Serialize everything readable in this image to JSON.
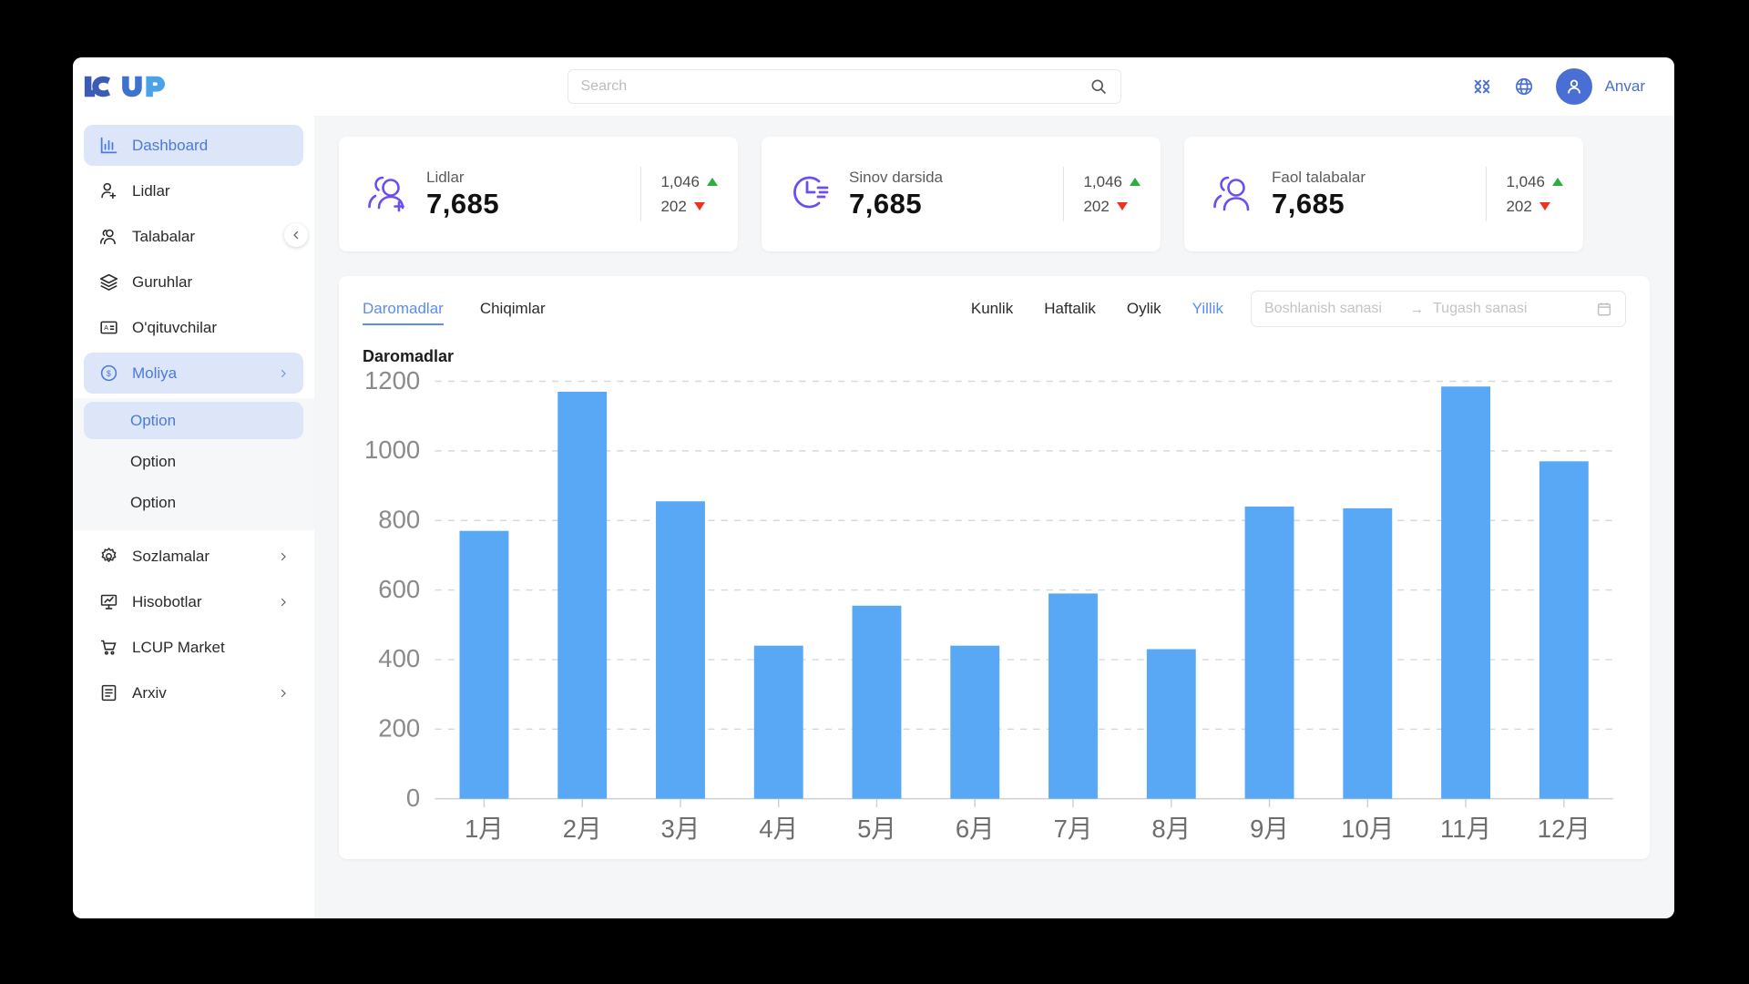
{
  "brand": {
    "logo_text": "LCUP"
  },
  "topbar": {
    "search": {
      "placeholder": "Search",
      "value": ""
    },
    "user_name": "Anvar",
    "icons": [
      "compress-icon",
      "globe-icon",
      "user-avatar-icon"
    ]
  },
  "sidebar": {
    "items": [
      {
        "label": "Dashboard",
        "icon": "bar-chart-icon",
        "active": true,
        "chevron": false
      },
      {
        "label": "Lidlar",
        "icon": "user-plus-icon",
        "active": false,
        "chevron": false
      },
      {
        "label": "Talabalar",
        "icon": "users-icon",
        "active": false,
        "chevron": false
      },
      {
        "label": "Guruhlar",
        "icon": "layers-icon",
        "active": false,
        "chevron": false
      },
      {
        "label": "O'qituvchilar",
        "icon": "id-card-icon",
        "active": false,
        "chevron": false
      },
      {
        "label": "Moliya",
        "icon": "dollar-circle-icon",
        "active": true,
        "chevron": true
      }
    ],
    "submenu": [
      {
        "label": "Option",
        "active": true
      },
      {
        "label": "Option",
        "active": false
      },
      {
        "label": "Option",
        "active": false
      }
    ],
    "items_bottom": [
      {
        "label": "Sozlamalar",
        "icon": "gear-icon",
        "active": false,
        "chevron": true
      },
      {
        "label": "Hisobotlar",
        "icon": "presentation-chart-icon",
        "active": false,
        "chevron": true
      },
      {
        "label": "LCUP Market",
        "icon": "shopping-cart-icon",
        "active": false,
        "chevron": false
      },
      {
        "label": "Arxiv",
        "icon": "archive-icon",
        "active": false,
        "chevron": true
      }
    ]
  },
  "cards": [
    {
      "label": "Lidlar",
      "value": "7,685",
      "up": "1,046",
      "down": "202",
      "icon": "user-plus-icon"
    },
    {
      "label": "Sinov darsida",
      "value": "7,685",
      "up": "1,046",
      "down": "202",
      "icon": "clock-icon"
    },
    {
      "label": "Faol talabalar",
      "value": "7,685",
      "up": "1,046",
      "down": "202",
      "icon": "users-icon"
    }
  ],
  "panel": {
    "tabs": [
      {
        "label": "Daromadlar",
        "active": true
      },
      {
        "label": "Chiqimlar",
        "active": false
      }
    ],
    "periods": [
      {
        "label": "Kunlik",
        "active": false
      },
      {
        "label": "Haftalik",
        "active": false
      },
      {
        "label": "Oylik",
        "active": false
      },
      {
        "label": "Yillik",
        "active": true
      }
    ],
    "date_range": {
      "start_placeholder": "Boshlanish sanasi",
      "end_placeholder": "Tugash sanasi",
      "start_value": "",
      "end_value": "",
      "separator": "→"
    }
  },
  "chart_data": {
    "type": "bar",
    "title": "Daromadlar",
    "xlabel": "",
    "ylabel": "",
    "ylim": [
      0,
      1200
    ],
    "yticks": [
      0,
      200,
      400,
      600,
      800,
      1000,
      1200
    ],
    "grid": true,
    "legend": "none",
    "bar_color": "#58a8f5",
    "categories": [
      "1月",
      "2月",
      "3月",
      "4月",
      "5月",
      "6月",
      "7月",
      "8月",
      "9月",
      "10月",
      "11月",
      "12月"
    ],
    "values": [
      770,
      1170,
      855,
      440,
      555,
      440,
      590,
      430,
      840,
      835,
      1185,
      970
    ]
  },
  "colors": {
    "accent_blue": "#5b8df0",
    "sidebar_active_bg": "#dde6f9",
    "card_icon_purple": "#6c4ef0",
    "bar_blue": "#58a8f5",
    "up_green": "#2bad3f",
    "down_red": "#ee3322"
  }
}
